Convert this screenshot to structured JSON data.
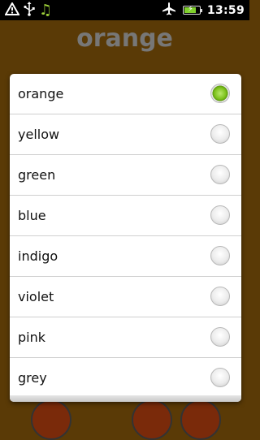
{
  "status_bar": {
    "time": "13:59",
    "left_icons": [
      "signal-warning-icon",
      "usb-icon",
      "music-note-icon"
    ],
    "right_icons": [
      "airplane-icon",
      "battery-charging-icon"
    ],
    "battery_level": 0.8,
    "colors": {
      "background": "#000000",
      "music": "#9fd23a",
      "battery": "#7fd02b"
    }
  },
  "app": {
    "title": "orange",
    "colors": {
      "background": "#5a3a06",
      "title": "#777777"
    }
  },
  "dialog": {
    "selected": "orange",
    "options": [
      {
        "label": "orange",
        "checked": true
      },
      {
        "label": "yellow",
        "checked": false
      },
      {
        "label": "green",
        "checked": false
      },
      {
        "label": "blue",
        "checked": false
      },
      {
        "label": "indigo",
        "checked": false
      },
      {
        "label": "violet",
        "checked": false
      },
      {
        "label": "pink",
        "checked": false
      },
      {
        "label": "grey",
        "checked": false
      }
    ],
    "colors": {
      "checked_radio": "#7dc21c"
    }
  }
}
